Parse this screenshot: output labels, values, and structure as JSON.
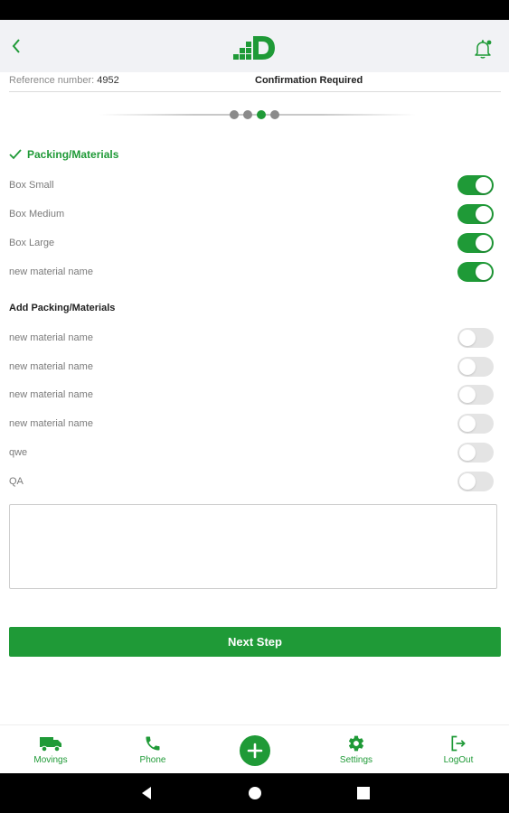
{
  "header": {
    "back_icon": "chevron-left-icon",
    "logo_icon": "app-logo",
    "bell_icon": "notification-bell-icon"
  },
  "order": {
    "reference_label": "Reference number:",
    "reference_number": "4952",
    "status": "Confirmation Required"
  },
  "stepper": {
    "total_steps": 4,
    "current_step": 3
  },
  "packing": {
    "title": "Packing/Materials",
    "items": [
      {
        "label": "Box Small",
        "enabled": true
      },
      {
        "label": "Box Medium",
        "enabled": true
      },
      {
        "label": "Box Large",
        "enabled": true
      },
      {
        "label": "new material name",
        "enabled": true
      }
    ]
  },
  "add_packing": {
    "title": "Add Packing/Materials",
    "items": [
      {
        "label": "new material name",
        "enabled": false
      },
      {
        "label": "new material name",
        "enabled": false
      },
      {
        "label": "new material name",
        "enabled": false
      },
      {
        "label": "new material name",
        "enabled": false
      },
      {
        "label": "qwe",
        "enabled": false
      },
      {
        "label": "QA",
        "enabled": false
      }
    ]
  },
  "notes": {
    "value": "",
    "placeholder": ""
  },
  "actions": {
    "next_label": "Next Step"
  },
  "bottom_nav": {
    "items": [
      {
        "label": "Movings",
        "icon": "truck-icon"
      },
      {
        "label": "Phone",
        "icon": "phone-icon"
      },
      {
        "label": "",
        "icon": "plus-icon"
      },
      {
        "label": "Settings",
        "icon": "gear-icon"
      },
      {
        "label": "LogOut",
        "icon": "logout-icon"
      }
    ]
  },
  "colors": {
    "accent": "#1f9a37",
    "toggle_off": "#e4e4e4",
    "appbar_bg": "#f1f2f5"
  }
}
